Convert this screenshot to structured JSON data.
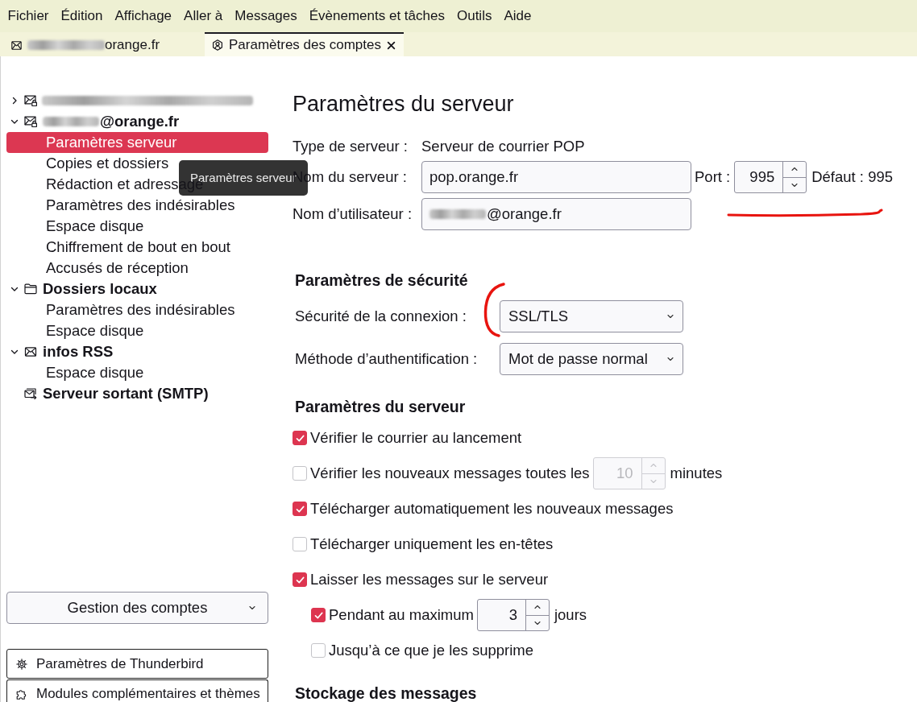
{
  "menu_bar": [
    "Fichier",
    "Édition",
    "Affichage",
    "Aller à",
    "Messages",
    "Évènements et tâches",
    "Outils",
    "Aide"
  ],
  "tabs": [
    {
      "kind": "mail",
      "label": "orange.fr",
      "blurred_prefix": true,
      "closable": false,
      "selected": false
    },
    {
      "kind": "account-settings",
      "label": "Paramètres des comptes",
      "closable": true,
      "selected": true
    }
  ],
  "sidebar": {
    "accounts": [
      {
        "kind": "mail-account",
        "blurred_name": true,
        "expanded": false,
        "selected": false
      },
      {
        "kind": "mail-account",
        "name": "@orange.fr",
        "blurred_name": true,
        "expanded": true,
        "selected": false,
        "children": [
          {
            "label": "Paramètres serveur",
            "selected": true
          },
          {
            "label": "Copies et dossiers",
            "selected": false
          },
          {
            "label": "Rédaction et adressage",
            "selected": false
          },
          {
            "label": "Paramètres des indésirables",
            "selected": false
          },
          {
            "label": "Espace disque",
            "selected": false
          },
          {
            "label": "Chiffrement de bout en bout",
            "selected": false
          },
          {
            "label": "Accusés de réception",
            "selected": false
          }
        ]
      },
      {
        "kind": "local-folders",
        "name": "Dossiers locaux",
        "expanded": true,
        "selected": false,
        "children": [
          {
            "label": "Paramètres des indésirables",
            "selected": false
          },
          {
            "label": "Espace disque",
            "selected": false
          }
        ]
      },
      {
        "kind": "feeds",
        "name": "infos RSS",
        "expanded": true,
        "selected": false,
        "children": [
          {
            "label": "Espace disque",
            "selected": false
          }
        ]
      },
      {
        "kind": "outgoing-server",
        "name": "Serveur sortant (SMTP)",
        "selected": false
      }
    ],
    "account_actions": {
      "label": "Gestion des comptes"
    },
    "footer_buttons": [
      {
        "kind": "settings",
        "label": "Paramètres de Thunderbird"
      },
      {
        "kind": "addons",
        "label": "Modules complémentaires et thèmes"
      }
    ]
  },
  "tooltip": {
    "text": "Paramètres serveur"
  },
  "main": {
    "title": "Paramètres du serveur",
    "server_type": {
      "label": "Type de serveur :",
      "value": "Serveur de courrier POP"
    },
    "server_name": {
      "label": "Nom du serveur :",
      "value": "pop.orange.fr"
    },
    "port": {
      "label": "Port :",
      "value": "995",
      "default": "Défaut : 995",
      "hand_drawn_underline": true
    },
    "username": {
      "label": "Nom d’utilisateur :",
      "value": "@orange.fr",
      "blurred_prefix": true
    },
    "security": {
      "heading": "Paramètres de sécurité",
      "fields": [
        {
          "label": "Sécurité de la connexion :",
          "value": "SSL/TLS",
          "hand_drawn_bracket": true
        },
        {
          "label": "Méthode d’authentification :",
          "value": "Mot de passe normal",
          "hand_drawn_bracket": false
        }
      ]
    },
    "server_settings": {
      "heading": "Paramètres du serveur",
      "options": [
        {
          "kind": "checkbox",
          "label": "Vérifier le courrier au lancement",
          "checked": true
        },
        {
          "kind": "interval",
          "label": "Vérifier les nouveaux messages toutes les",
          "checked": false,
          "value": "10",
          "unit": "minutes"
        },
        {
          "kind": "checkbox",
          "label": "Télécharger automatiquement les nouveaux messages",
          "checked": true
        },
        {
          "kind": "checkbox",
          "label": "Télécharger uniquement les en-têtes",
          "checked": false
        },
        {
          "kind": "checkbox",
          "label": "Laisser les messages sur le serveur",
          "checked": true,
          "children": [
            {
              "kind": "interval",
              "label": "Pendant au maximum",
              "checked": true,
              "value": "3",
              "unit": "jours"
            },
            {
              "kind": "checkbox",
              "label": "Jusqu’à ce que je les supprime",
              "checked": false
            }
          ]
        }
      ]
    },
    "storage": {
      "heading": "Stockage des messages"
    }
  }
}
